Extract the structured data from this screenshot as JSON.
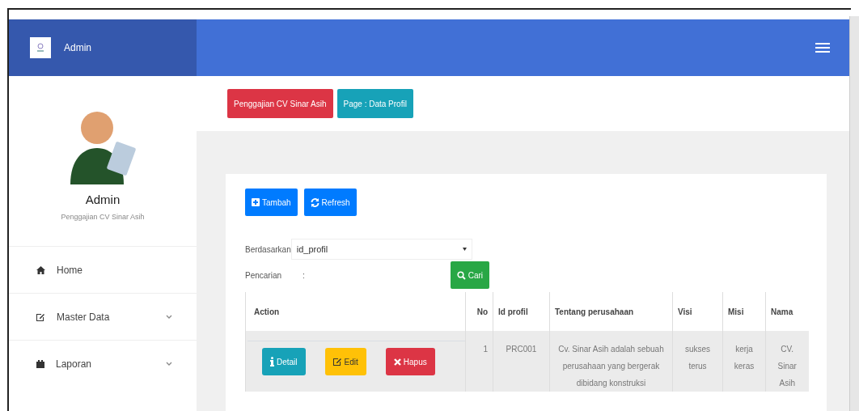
{
  "header": {
    "brand": "Admin"
  },
  "sidebar": {
    "user_name": "Admin",
    "user_role": "Penggajian CV Sinar Asih",
    "items": [
      {
        "label": "Home",
        "kind": "home",
        "expandable": false
      },
      {
        "label": "Master Data",
        "kind": "edit",
        "expandable": true
      },
      {
        "label": "Laporan",
        "kind": "calendar",
        "expandable": true
      }
    ]
  },
  "badges": [
    {
      "text": "Penggajian CV Sinar Asih",
      "color": "#dc3545"
    },
    {
      "text": "Page : Data Profil",
      "color": "#17a2b8"
    }
  ],
  "toolbar": [
    {
      "label": "Tambah",
      "kind": "add"
    },
    {
      "label": "Refresh",
      "kind": "refresh"
    }
  ],
  "filter": {
    "by_label": "Berdasarkan",
    "by_value": "id_profil",
    "search_label": "Pencarian",
    "search_colon": ":",
    "search_button": "Cari"
  },
  "table": {
    "columns": [
      "Action",
      "No",
      "Id profil",
      "Tentang perusahaan",
      "Visi",
      "Misi",
      "Nama"
    ],
    "rows": [
      {
        "cells": [
          {
            "actions": [
              {
                "label": "Detail",
                "kind": "info"
              },
              {
                "label": "Edit",
                "kind": "edit"
              },
              {
                "label": "Hapus",
                "kind": "delete"
              }
            ]
          },
          "1",
          "PRC001",
          "Cv. Sinar Asih adalah sebuah perusahaan yang bergerak dibidang konstruksi",
          "sukses terus",
          "kerja keras",
          "CV. Sinar Asih"
        ]
      }
    ]
  }
}
